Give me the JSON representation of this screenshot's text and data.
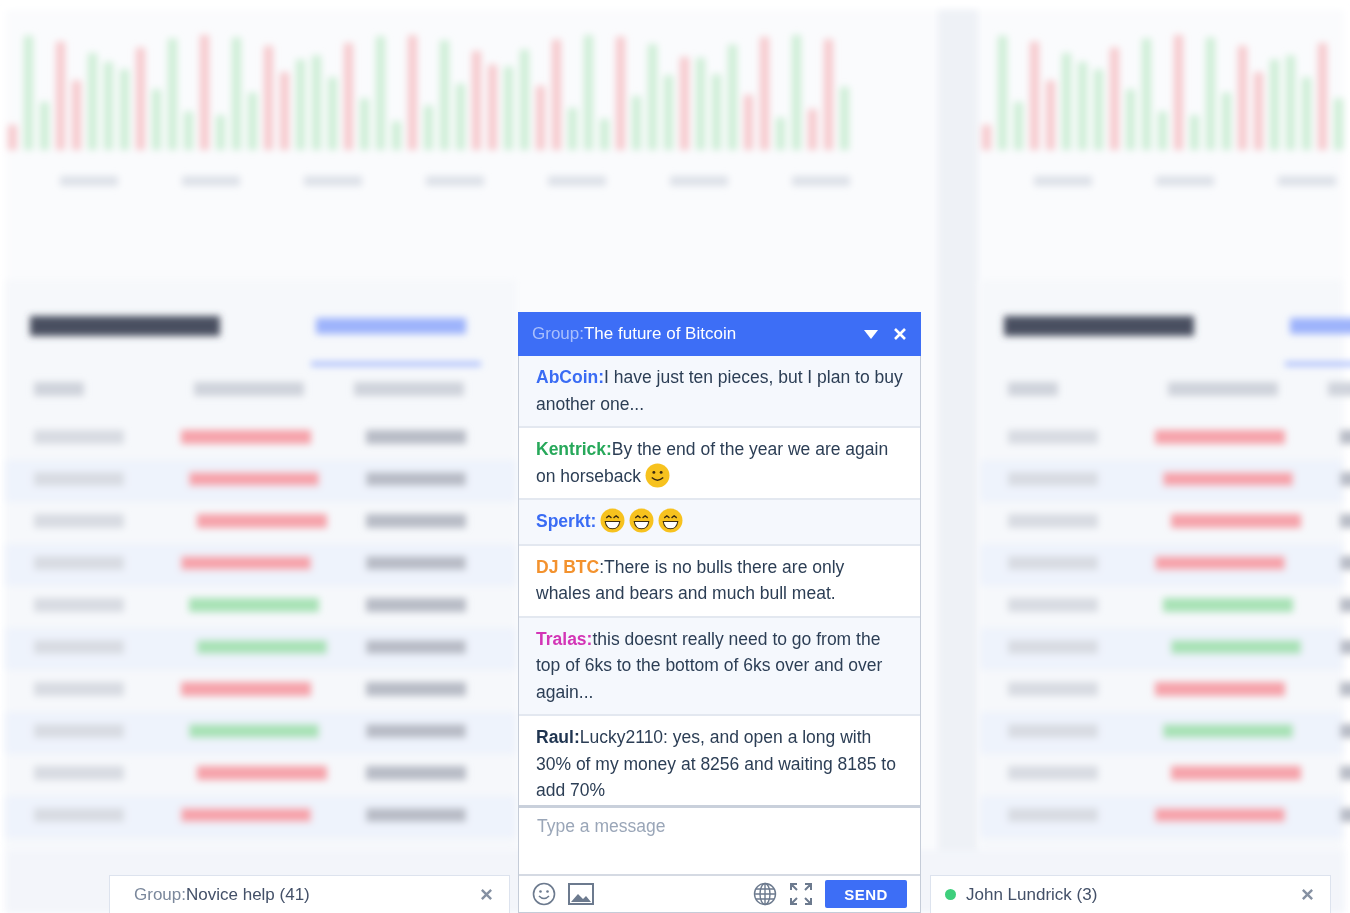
{
  "chat": {
    "group_label": "Group:",
    "title": "The future of Bitcoin",
    "messages": [
      {
        "author": "AbCoin:",
        "color": "#3a6cf4",
        "text": "I have just ten pieces, but I plan to buy another one..."
      },
      {
        "author": "Kentrick:",
        "color": "#27a85a",
        "text": "By the end of the year we are again on horseback",
        "emojis": [
          {
            "kind": "smile"
          }
        ]
      },
      {
        "author": "Sperkt:",
        "color": "#3a6cf4",
        "emojis": [
          {
            "kind": "grin"
          },
          {
            "kind": "grin"
          },
          {
            "kind": "grin"
          }
        ]
      },
      {
        "author": "DJ BTC",
        "color": "#f3922e",
        "text": ":There is no bulls there are only whales and bears and much bull meat."
      },
      {
        "author": "Tralas:",
        "color": "#d335b6",
        "text": "this doesnt really need to go from the top of 6ks to the bottom of 6ks over and over again..."
      },
      {
        "author": "Raul:",
        "color": "#1f3450",
        "text": "Lucky2110: yes, and open a long with 30% of my money at 8256 and waiting 8185 to add 70%"
      }
    ],
    "input": {
      "placeholder": "Type a message"
    },
    "send_label": "SEND"
  },
  "minimized_chats": [
    {
      "kind": "group",
      "group_label": "Group:",
      "title": "Novice help (41)"
    },
    {
      "kind": "person",
      "title": "John Lundrick (3)",
      "online": true
    }
  ]
}
